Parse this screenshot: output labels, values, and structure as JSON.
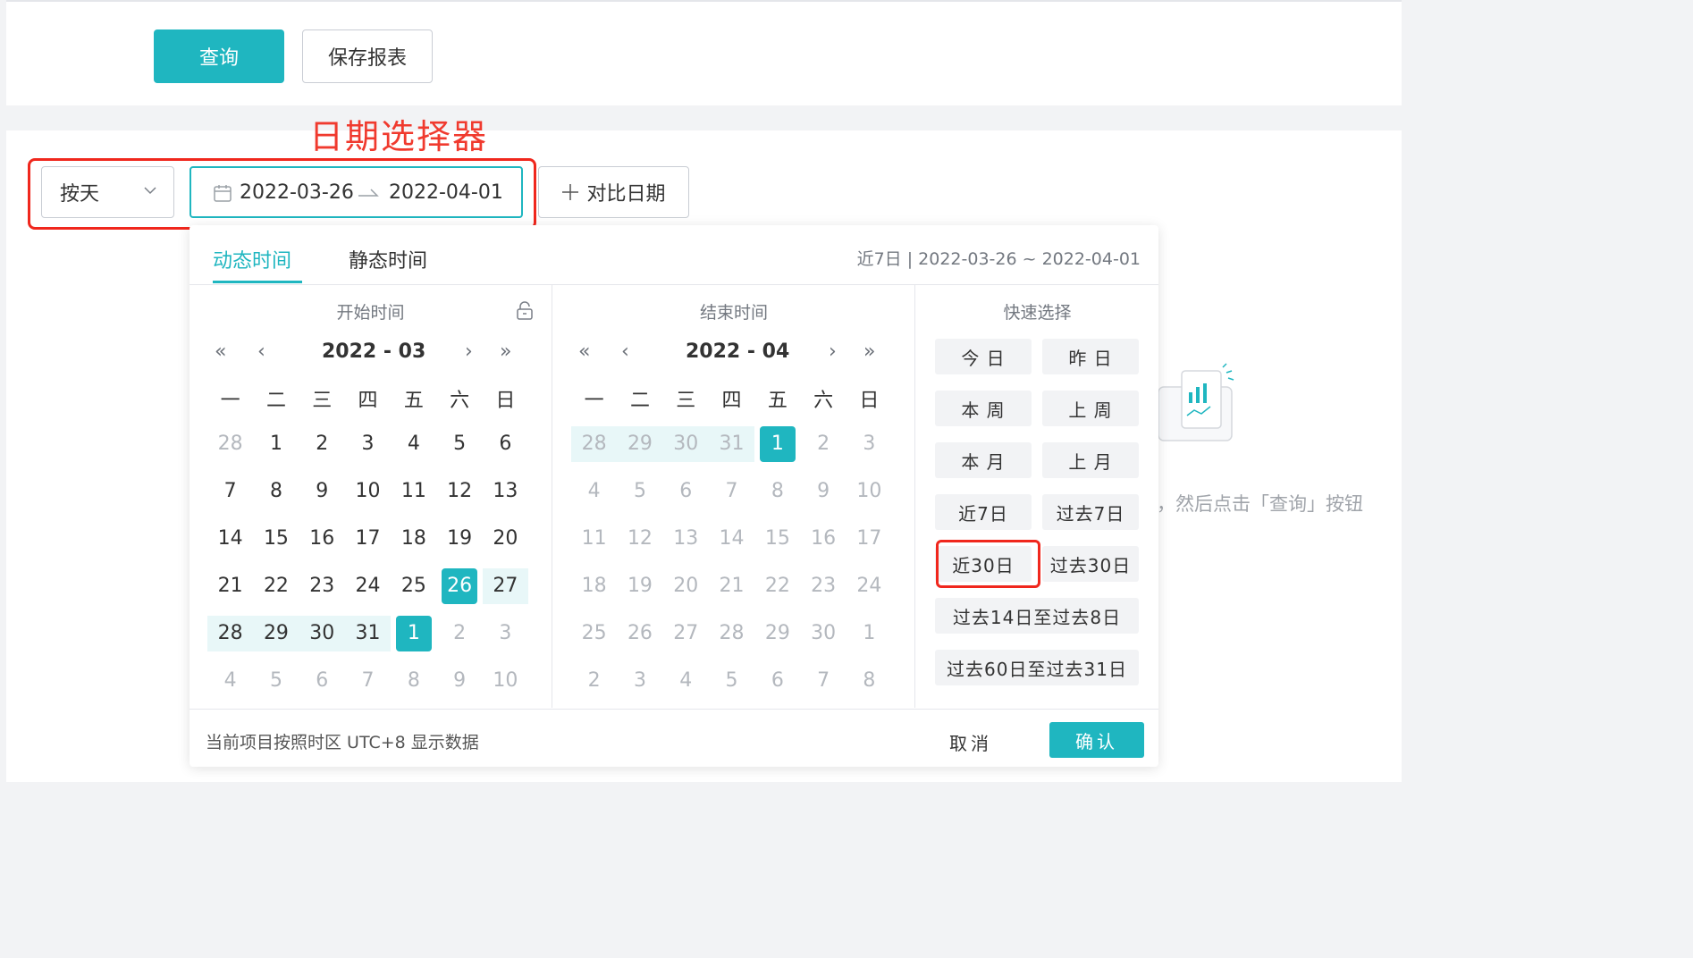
{
  "toolbar": {
    "query_label": "查询",
    "save_label": "保存报表"
  },
  "annotation": {
    "title": "日期选择器"
  },
  "granularity": {
    "value": "按天"
  },
  "date_range": {
    "start": "2022-03-26",
    "end": "2022-04-01"
  },
  "compare": {
    "label": "对比日期"
  },
  "background_hint": "，然后点击「查询」按钮",
  "picker": {
    "tabs": [
      {
        "label": "动态时间",
        "active": true
      },
      {
        "label": "静态时间",
        "active": false
      }
    ],
    "summary": "近7日  |  2022-03-26 ~ 2022-04-01",
    "weekdays": [
      "一",
      "二",
      "三",
      "四",
      "五",
      "六",
      "日"
    ],
    "start_panel": {
      "title": "开始时间",
      "year_month": "2022 - 03",
      "weeks": [
        [
          {
            "d": "28",
            "s": "muted"
          },
          {
            "d": "1"
          },
          {
            "d": "2"
          },
          {
            "d": "3"
          },
          {
            "d": "4"
          },
          {
            "d": "5"
          },
          {
            "d": "6"
          }
        ],
        [
          {
            "d": "7"
          },
          {
            "d": "8"
          },
          {
            "d": "9"
          },
          {
            "d": "10"
          },
          {
            "d": "11"
          },
          {
            "d": "12"
          },
          {
            "d": "13"
          }
        ],
        [
          {
            "d": "14"
          },
          {
            "d": "15"
          },
          {
            "d": "16"
          },
          {
            "d": "17"
          },
          {
            "d": "18"
          },
          {
            "d": "19"
          },
          {
            "d": "20"
          }
        ],
        [
          {
            "d": "21"
          },
          {
            "d": "22"
          },
          {
            "d": "23"
          },
          {
            "d": "24"
          },
          {
            "d": "25"
          },
          {
            "d": "26",
            "s": "sel"
          },
          {
            "d": "27",
            "s": "inrange"
          }
        ],
        [
          {
            "d": "28",
            "s": "inrange"
          },
          {
            "d": "29",
            "s": "inrange"
          },
          {
            "d": "30",
            "s": "inrange"
          },
          {
            "d": "31",
            "s": "inrange"
          },
          {
            "d": "1",
            "s": "sel"
          },
          {
            "d": "2",
            "s": "muted"
          },
          {
            "d": "3",
            "s": "muted"
          }
        ],
        [
          {
            "d": "4",
            "s": "muted"
          },
          {
            "d": "5",
            "s": "muted"
          },
          {
            "d": "6",
            "s": "muted"
          },
          {
            "d": "7",
            "s": "muted"
          },
          {
            "d": "8",
            "s": "muted"
          },
          {
            "d": "9",
            "s": "muted"
          },
          {
            "d": "10",
            "s": "muted"
          }
        ]
      ]
    },
    "end_panel": {
      "title": "结束时间",
      "year_month": "2022 - 04",
      "weeks": [
        [
          {
            "d": "28",
            "s": "muted inrange"
          },
          {
            "d": "29",
            "s": "muted inrange"
          },
          {
            "d": "30",
            "s": "muted inrange"
          },
          {
            "d": "31",
            "s": "muted inrange"
          },
          {
            "d": "1",
            "s": "sel"
          },
          {
            "d": "2",
            "s": "muted"
          },
          {
            "d": "3",
            "s": "muted"
          }
        ],
        [
          {
            "d": "4",
            "s": "muted"
          },
          {
            "d": "5",
            "s": "muted"
          },
          {
            "d": "6",
            "s": "muted"
          },
          {
            "d": "7",
            "s": "muted"
          },
          {
            "d": "8",
            "s": "muted"
          },
          {
            "d": "9",
            "s": "muted"
          },
          {
            "d": "10",
            "s": "muted"
          }
        ],
        [
          {
            "d": "11",
            "s": "muted"
          },
          {
            "d": "12",
            "s": "muted"
          },
          {
            "d": "13",
            "s": "muted"
          },
          {
            "d": "14",
            "s": "muted"
          },
          {
            "d": "15",
            "s": "muted"
          },
          {
            "d": "16",
            "s": "muted"
          },
          {
            "d": "17",
            "s": "muted"
          }
        ],
        [
          {
            "d": "18",
            "s": "muted"
          },
          {
            "d": "19",
            "s": "muted"
          },
          {
            "d": "20",
            "s": "muted"
          },
          {
            "d": "21",
            "s": "muted"
          },
          {
            "d": "22",
            "s": "muted"
          },
          {
            "d": "23",
            "s": "muted"
          },
          {
            "d": "24",
            "s": "muted"
          }
        ],
        [
          {
            "d": "25",
            "s": "muted"
          },
          {
            "d": "26",
            "s": "muted"
          },
          {
            "d": "27",
            "s": "muted"
          },
          {
            "d": "28",
            "s": "muted"
          },
          {
            "d": "29",
            "s": "muted"
          },
          {
            "d": "30",
            "s": "muted"
          },
          {
            "d": "1",
            "s": "muted"
          }
        ],
        [
          {
            "d": "2",
            "s": "muted"
          },
          {
            "d": "3",
            "s": "muted"
          },
          {
            "d": "4",
            "s": "muted"
          },
          {
            "d": "5",
            "s": "muted"
          },
          {
            "d": "6",
            "s": "muted"
          },
          {
            "d": "7",
            "s": "muted"
          },
          {
            "d": "8",
            "s": "muted"
          }
        ]
      ]
    },
    "quick": {
      "title": "快速选择",
      "items": [
        "今 日",
        "昨 日",
        "本 周",
        "上 周",
        "本 月",
        "上 月",
        "近7日",
        "过去7日",
        "近30日",
        "过去30日",
        "过去14日至过去8日",
        "过去60日至过去31日"
      ]
    },
    "footer": {
      "timezone_note": "当前项目按照时区 UTC+8 显示数据",
      "cancel": "取消",
      "confirm": "确认"
    }
  },
  "colors": {
    "accent": "#1fb6c0",
    "annotation": "#f0271d",
    "range_bg": "#e8f7f8"
  }
}
